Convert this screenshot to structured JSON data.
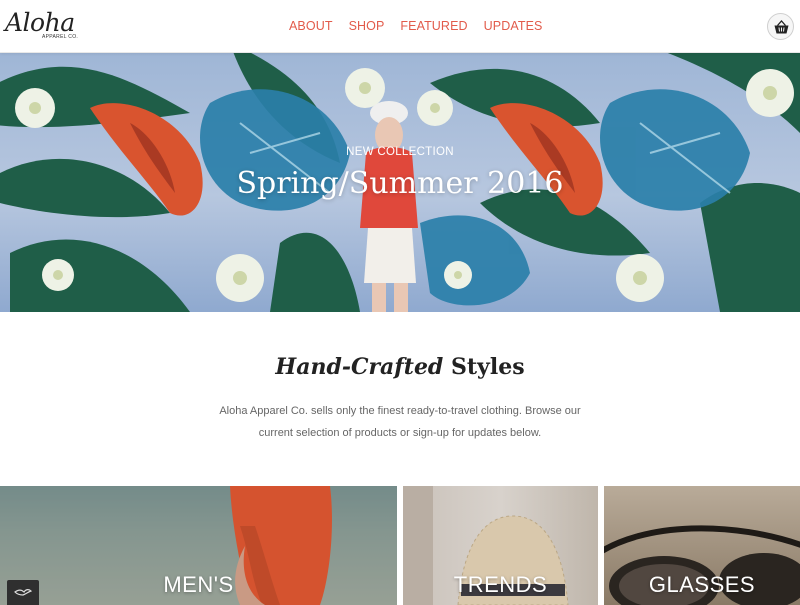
{
  "brand": {
    "logo_text": "Aloha",
    "logo_subtext": "APPAREL CO."
  },
  "nav": {
    "items": [
      {
        "label": "ABOUT"
      },
      {
        "label": "SHOP"
      },
      {
        "label": "FEATURED"
      },
      {
        "label": "UPDATES"
      }
    ]
  },
  "header": {
    "cart_icon": "basket-icon"
  },
  "hero": {
    "eyebrow": "NEW COLLECTION",
    "title": "Spring/Summer 2016"
  },
  "intro": {
    "title_italic": "Hand-Crafted",
    "title_bold": "Styles",
    "text": "Aloha Apparel Co. sells only the finest ready-to-travel clothing. Browse our current selection of products or sign-up for updates below."
  },
  "categories": [
    {
      "label": "MEN'S"
    },
    {
      "label": "TRENDS"
    },
    {
      "label": "GLASSES"
    }
  ],
  "colors": {
    "accent": "#e25b4b",
    "text": "#222222",
    "muted": "#666666"
  }
}
